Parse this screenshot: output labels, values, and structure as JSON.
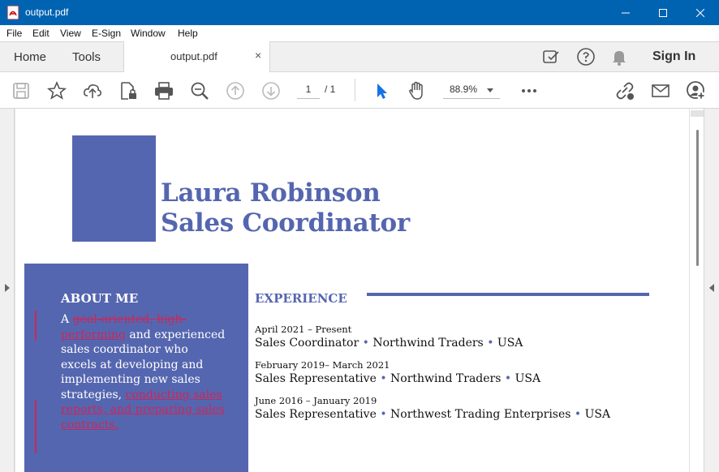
{
  "window": {
    "title": "output.pdf"
  },
  "menu": [
    "File",
    "Edit",
    "View",
    "E-Sign",
    "Window",
    "Help"
  ],
  "tabs": {
    "home": "Home",
    "tools": "Tools",
    "document": "output.pdf",
    "close_glyph": "×",
    "sign_in": "Sign In"
  },
  "toolbar": {
    "page_current": "1",
    "page_total": "/ 1",
    "zoom": "88.9%"
  },
  "icons": {
    "toolbar": [
      "save-icon",
      "bookmark-star-icon",
      "upload-cloud-icon",
      "protect-file-icon",
      "print-icon",
      "zoom-search-icon",
      "page-up-icon",
      "page-down-icon",
      "select-cursor-icon",
      "hand-pan-icon",
      "more-icon",
      "share-link-icon",
      "email-icon",
      "add-user-icon"
    ],
    "topbar": [
      "share-review-icon",
      "help-icon",
      "notifications-bell-icon"
    ]
  },
  "colors": {
    "titlebar": "#0063b1",
    "accent": "#5566b0",
    "revision": "#c8285a"
  },
  "document": {
    "name_line1": "Laura Robinson",
    "name_line2": "Sales Coordinator",
    "about": {
      "title": "ABOUT ME",
      "text_1": "A ",
      "deleted_1": "goal-oriented, high-",
      "inserted_1": "performing",
      "text_2": " and experienced sales coordinator who excels at developing and implementing new sales strategies, ",
      "inserted_2": "conducting sales reports, and preparing sales contracts."
    },
    "experience": {
      "title": "EXPERIENCE",
      "jobs": [
        {
          "dates": "April 2021 – Present",
          "role": "Sales Coordinator",
          "company": "Northwind Traders",
          "country": "USA"
        },
        {
          "dates": "February 2019– March 2021",
          "role": "Sales Representative",
          "company": "Northwind Traders",
          "country": "USA"
        },
        {
          "dates": "June 2016 – January 2019",
          "role": "Sales Representative",
          "company": "Northwest Trading Enterprises",
          "country": "USA"
        }
      ],
      "separator": "•"
    }
  }
}
